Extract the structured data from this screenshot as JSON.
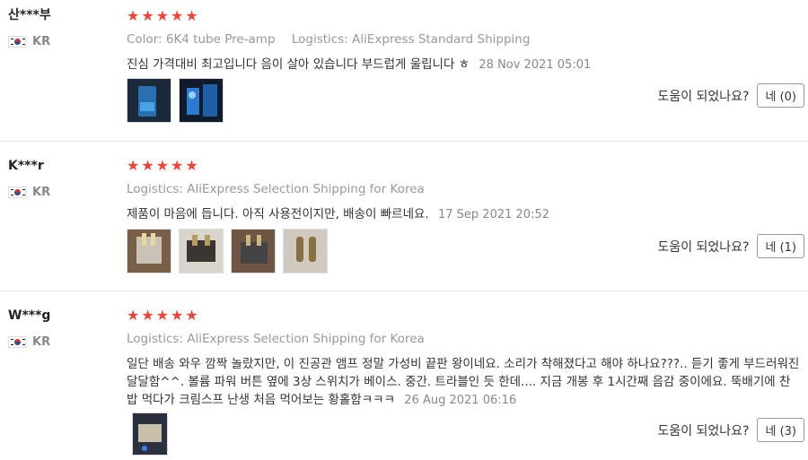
{
  "reviews": [
    {
      "user": "산***부",
      "country": "KR",
      "stars": 5,
      "color_label": "Color:",
      "color_value": "6K4 tube Pre-amp",
      "logistics_label": "Logistics:",
      "logistics_value": "AliExpress Standard Shipping",
      "text": "진심 가격대비 최고입니다 음이 살아 있습니다 부드럽게 울립니다 ㅎ",
      "date": "28 Nov 2021 05:01",
      "photos": 2,
      "helpful_label": "도움이 되었나요?",
      "helpful_button": "네 (0)"
    },
    {
      "user": "K***r",
      "country": "KR",
      "stars": 5,
      "logistics_label": "Logistics:",
      "logistics_value": "AliExpress Selection Shipping for Korea",
      "text": "제품이 마음에 듭니다. 아직 사용전이지만, 배송이 빠르네요.",
      "date": "17 Sep 2021 20:52",
      "photos": 4,
      "helpful_label": "도움이 되었나요?",
      "helpful_button": "네 (1)"
    },
    {
      "user": "W***g",
      "country": "KR",
      "stars": 5,
      "logistics_label": "Logistics:",
      "logistics_value": "AliExpress Selection Shipping for Korea",
      "text": "일단 배송 와우 깜짝 놀랐지만, 이 진공관 앰프 정말 가성비 끝판 왕이네요. 소리가 착해졌다고 해야 하나요???.. 듣기 좋게 부드러워진 달달함^^. 볼륨 파워 버튼 옆에 3상 스위치가 베이스. 중간. 트라블인 듯 한데.... 지금 개봉 후 1시간째 음감 중이에요. 뚝배기에 찬밥 먹다가 크림스프 난생 처음 먹어보는 황홀함ㅋㅋㅋ",
      "date": "26 Aug 2021 06:16",
      "photos": 1,
      "helpful_label": "도움이 되었나요?",
      "helpful_button": "네 (3)"
    }
  ]
}
